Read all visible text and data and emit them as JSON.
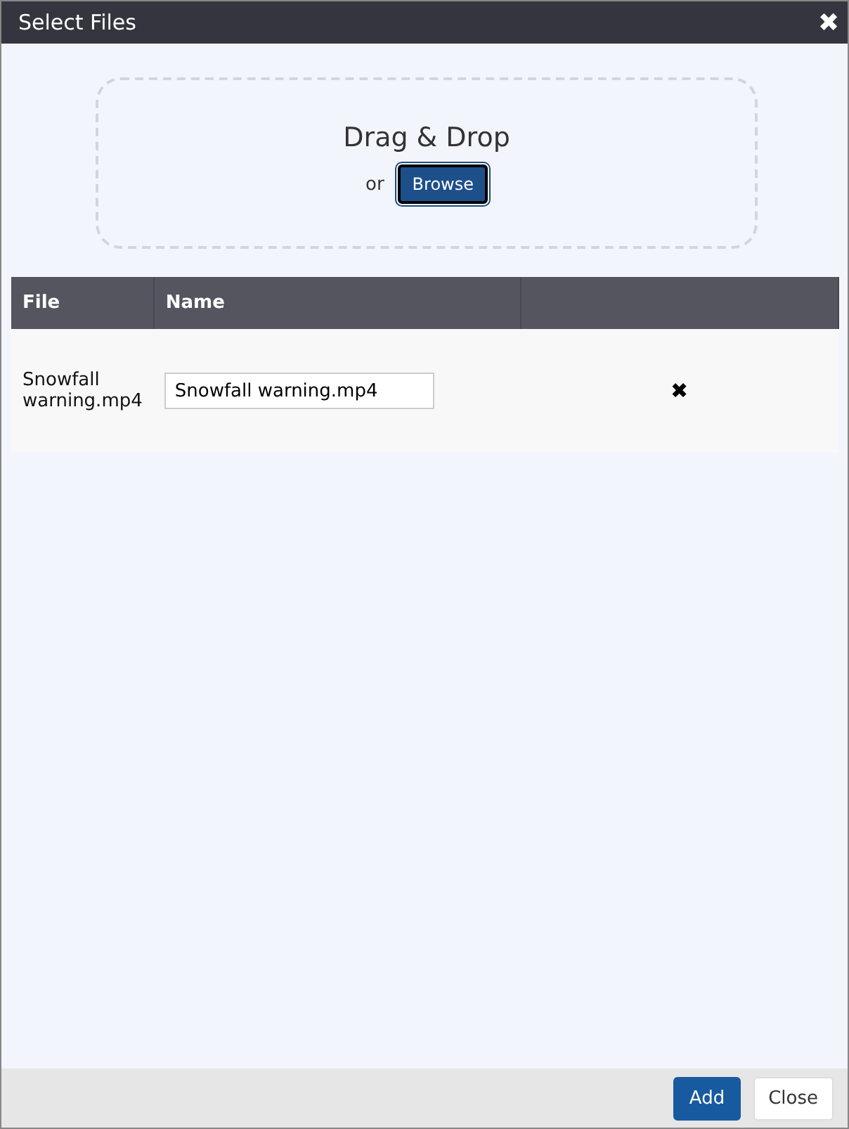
{
  "window": {
    "title": "Select Files",
    "close": "✖"
  },
  "drop_zone": {
    "title": "Drag & Drop",
    "or": "or",
    "browse": "Browse"
  },
  "table": {
    "columns": [
      "File",
      "Name"
    ],
    "rows": [
      {
        "file": "Snowfall warning.mp4",
        "name": "Snowfall warning.mp4",
        "remove": "✖"
      }
    ]
  },
  "buttons": [
    {
      "label": "Add",
      "kind": "primary"
    },
    {
      "label": "Close",
      "kind": "secondary"
    }
  ]
}
